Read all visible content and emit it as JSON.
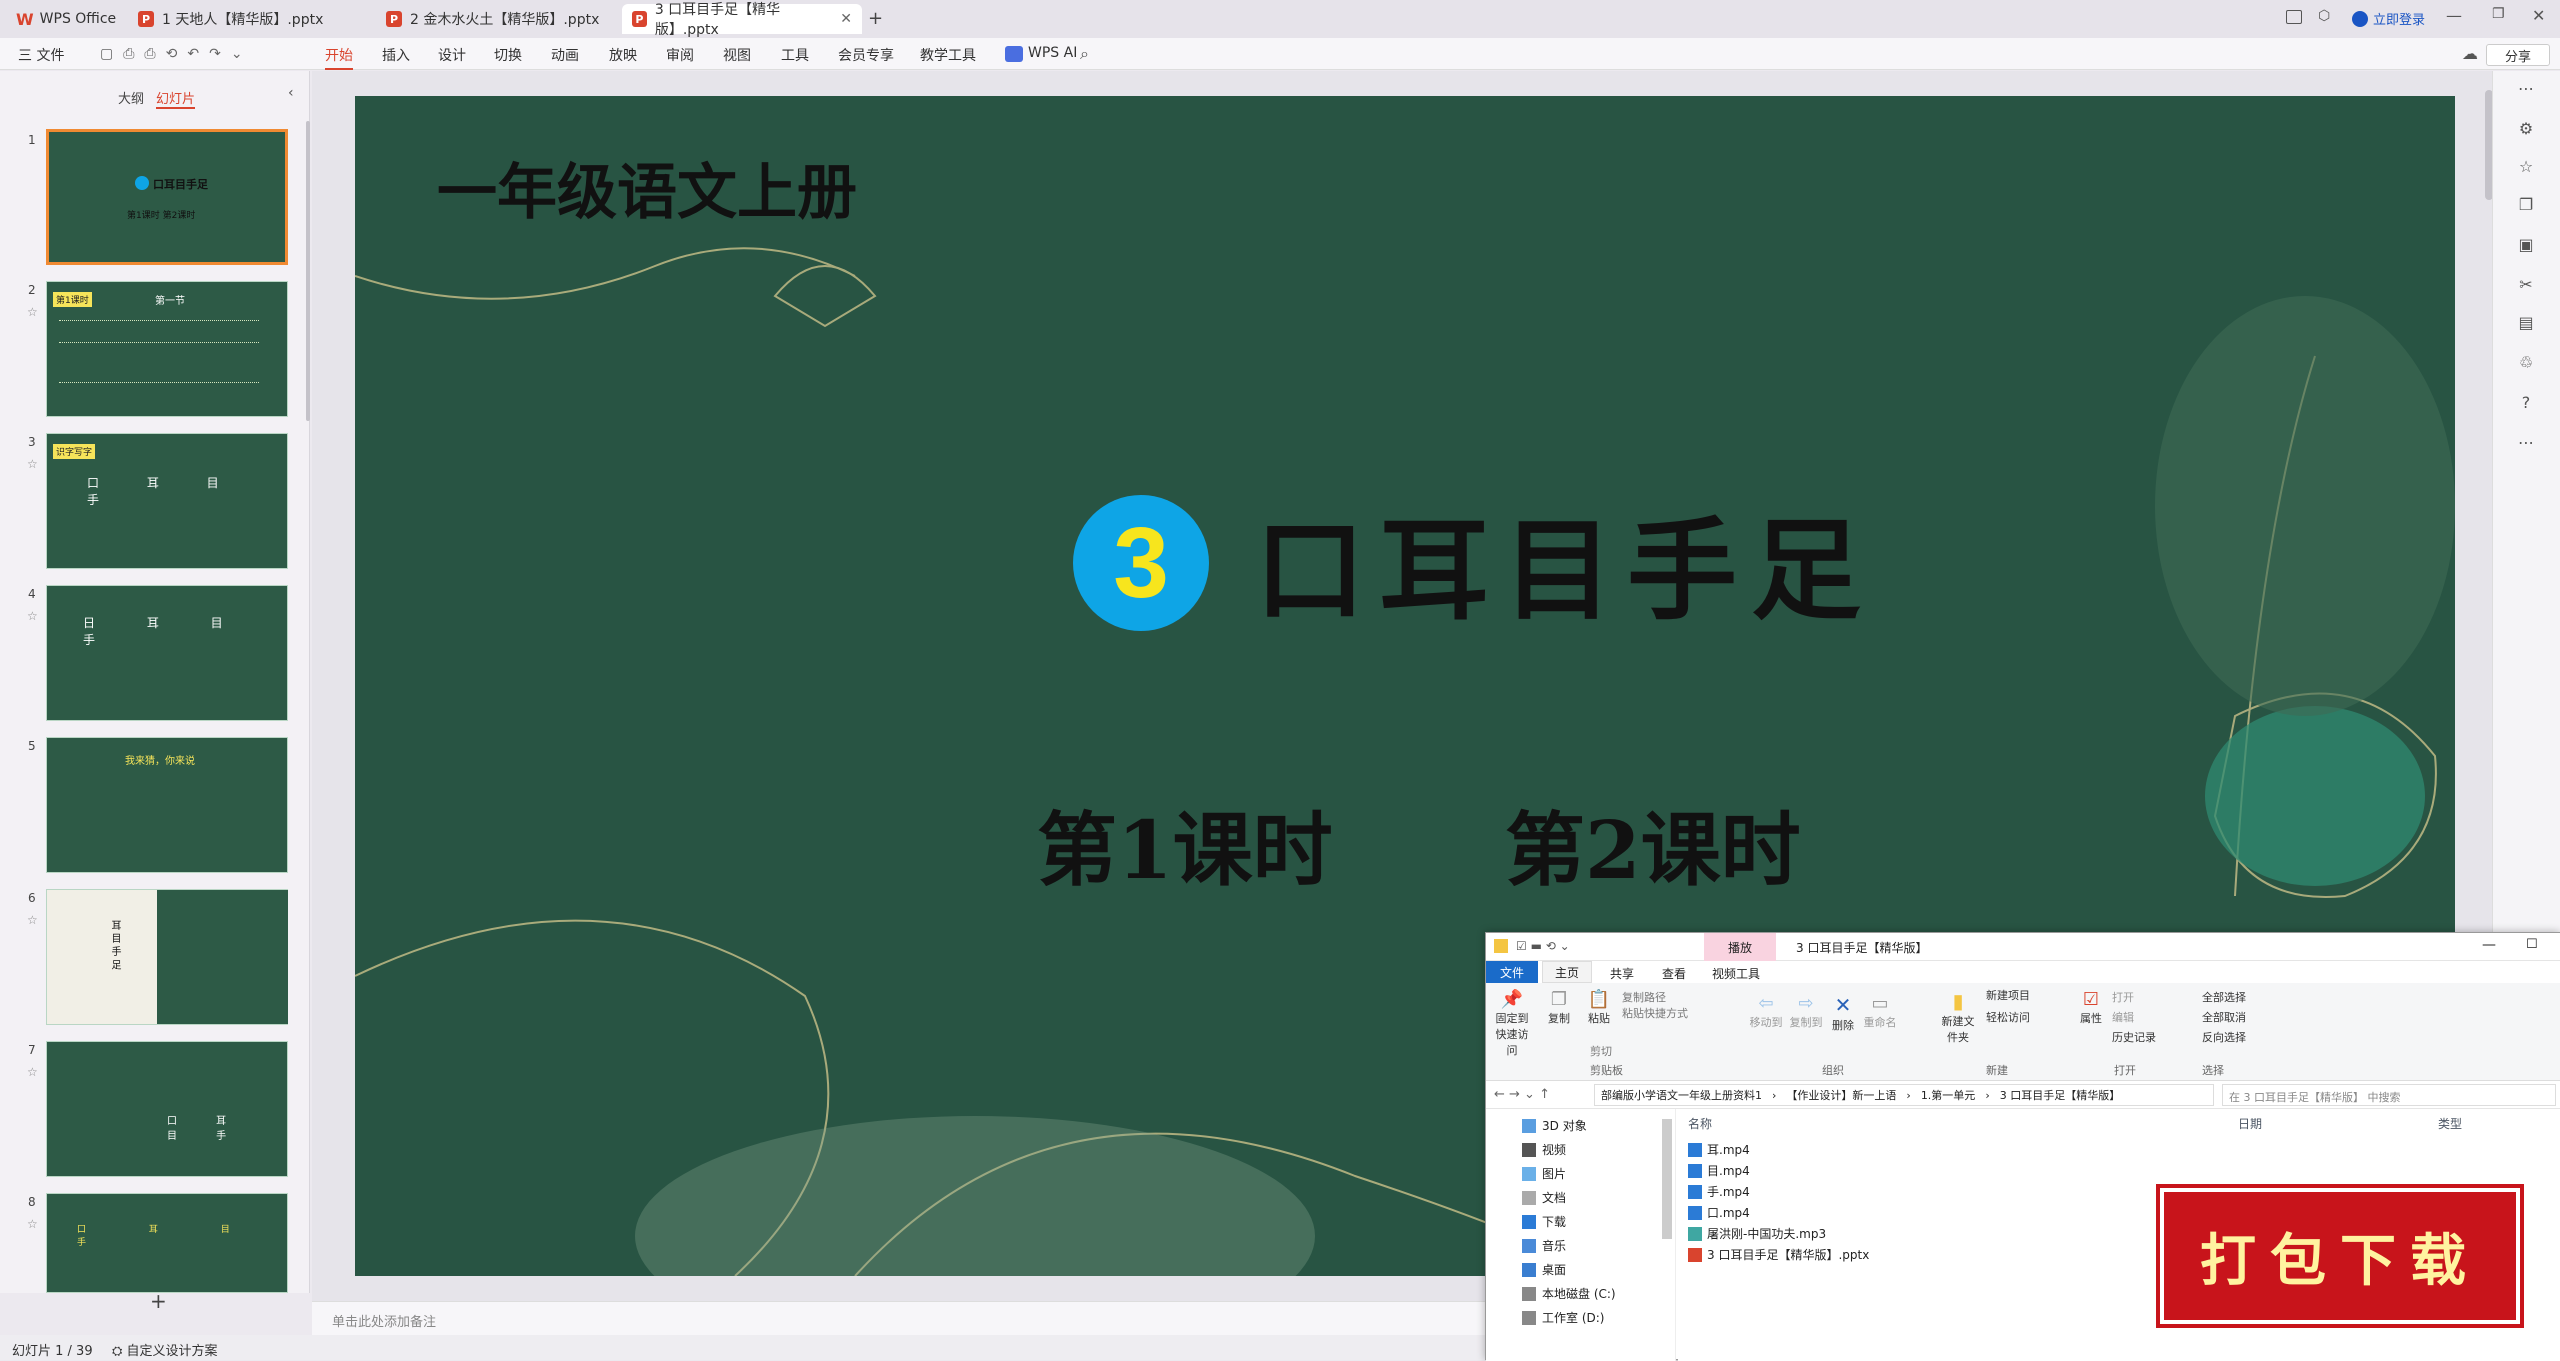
{
  "tabs": [
    {
      "label": "WPS Office"
    },
    {
      "label": "1 天地人【精华版】.pptx"
    },
    {
      "label": "2 金木水火土【精华版】.pptx"
    },
    {
      "label": "3 口耳目手足【精华版】.pptx"
    }
  ],
  "titlebar": {
    "login": "立即登录"
  },
  "menu": {
    "file": "三 文件",
    "items": [
      "开始",
      "插入",
      "设计",
      "切换",
      "动画",
      "放映",
      "审阅",
      "视图",
      "工具",
      "会员专享",
      "教学工具"
    ],
    "wps_ai": "WPS AI",
    "share": "分享"
  },
  "leftpanel": {
    "tab_outline": "大纲",
    "tab_slides": "幻灯片",
    "add": "+",
    "slides": [
      {
        "num": "1",
        "text": "口耳目手足",
        "sub": "第1课时  第2课时"
      },
      {
        "num": "2",
        "text": "第一节",
        "tag": "第1课时"
      },
      {
        "num": "3",
        "text": "口 耳 目 手",
        "tag": "识字写字"
      },
      {
        "num": "4",
        "text": "日 耳 目 手"
      },
      {
        "num": "5",
        "text": "我来猜，你来说"
      },
      {
        "num": "6",
        "text": "耳 目 手 足"
      },
      {
        "num": "7",
        "text": "口 耳 目 手"
      },
      {
        "num": "8",
        "text": "口 耳 目 手"
      }
    ]
  },
  "slide": {
    "grade_title": "一年级语文上册",
    "number": "3",
    "lesson_title": "口耳目手足",
    "period1": "第1课时",
    "period2": "第2课时"
  },
  "notes": {
    "placeholder": "单击此处添加备注"
  },
  "status": {
    "slide_count": "幻灯片 1 / 39",
    "design": "自定义设计方案"
  },
  "explorer": {
    "title": "3 口耳目手足【精华版】",
    "play_tab": "播放",
    "ribbon_tabs": [
      "文件",
      "主页",
      "共享",
      "查看",
      "视频工具"
    ],
    "clipboard": {
      "pin": "固定到快速访问",
      "copy": "复制",
      "paste": "粘贴",
      "copy_path": "复制路径",
      "paste_shortcut": "粘贴快捷方式",
      "cut": "剪切",
      "group": "剪贴板"
    },
    "organize": {
      "move": "移动到",
      "copyto": "复制到",
      "delete": "删除",
      "rename": "重命名",
      "group": "组织"
    },
    "new": {
      "folder": "新建文件夹",
      "item": "新建项目",
      "easy": "轻松访问",
      "group": "新建"
    },
    "open": {
      "props": "属性",
      "open": "打开",
      "edit": "编辑",
      "history": "历史记录",
      "group": "打开"
    },
    "select": {
      "all": "全部选择",
      "none": "全部取消",
      "invert": "反向选择",
      "group": "选择"
    },
    "path": [
      "部编版小学语文一年级上册资料1",
      "【作业设计】新一上语",
      "1.第一单元",
      "3 口耳目手足【精华版】"
    ],
    "search": "在 3 口耳目手足【精华版】 中搜索",
    "nav": [
      "3D 对象",
      "视频",
      "图片",
      "文档",
      "下载",
      "音乐",
      "桌面",
      "本地磁盘 (C:)",
      "工作室 (D:)"
    ],
    "columns": {
      "name": "名称",
      "date": "日期",
      "type": "类型"
    },
    "files": [
      "耳.mp4",
      "目.mp4",
      "手.mp4",
      "口.mp4",
      "屠洪刚-中国功夫.mp3",
      "3 口耳目手足【精华版】.pptx"
    ]
  },
  "banner": {
    "text": "打包下载"
  },
  "colors": {
    "slide_bg": "#285443",
    "accent": "#d9442e",
    "number_circle": "#0ea5e6",
    "number_text": "#f7e51d",
    "banner": "#c8141b"
  }
}
